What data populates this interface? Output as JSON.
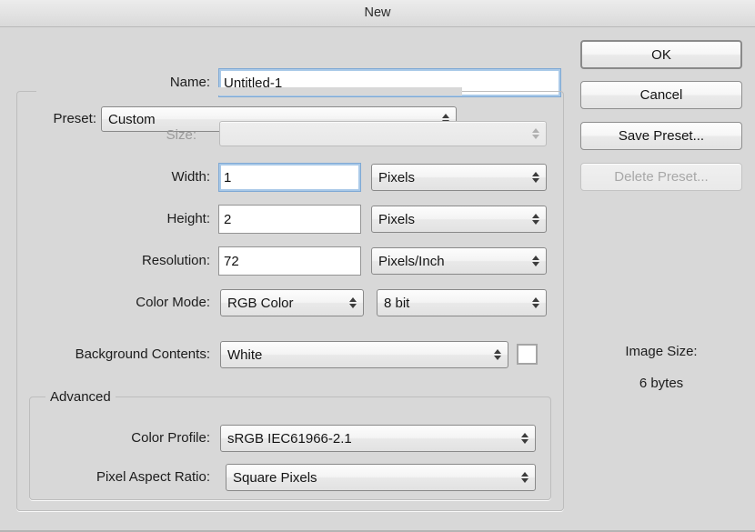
{
  "window": {
    "title": "New"
  },
  "name_row": {
    "label": "Name:",
    "value": "Untitled-1",
    "placeholder": "Untitled-1"
  },
  "preset_row": {
    "label": "Preset:",
    "value": "Custom"
  },
  "size_row": {
    "label": "Size:",
    "value": "",
    "enabled": false
  },
  "width_row": {
    "label": "Width:",
    "value": "1",
    "unit": "Pixels"
  },
  "height_row": {
    "label": "Height:",
    "value": "2",
    "unit": "Pixels"
  },
  "resolution_row": {
    "label": "Resolution:",
    "value": "72",
    "unit": "Pixels/Inch"
  },
  "color_mode_row": {
    "label": "Color Mode:",
    "value": "RGB Color",
    "depth": "8 bit"
  },
  "background_row": {
    "label": "Background Contents:",
    "value": "White",
    "swatch_color": "#ffffff"
  },
  "advanced": {
    "title": "Advanced",
    "color_profile": {
      "label": "Color Profile:",
      "value": "sRGB IEC61966-2.1"
    },
    "pixel_aspect_ratio": {
      "label": "Pixel Aspect Ratio:",
      "value": "Square Pixels"
    }
  },
  "image_size": {
    "label": "Image Size:",
    "value": "6 bytes"
  },
  "buttons": {
    "ok": "OK",
    "cancel": "Cancel",
    "save_preset": "Save Preset...",
    "delete_preset": "Delete Preset..."
  },
  "icons": {
    "stepper": "stepper-updown-icon"
  },
  "colors": {
    "dialog_background": "#d8d8d8",
    "focus_ring": "#a9c9e8",
    "field_background": "#ffffff",
    "disabled_text": "#9a9a9a"
  }
}
